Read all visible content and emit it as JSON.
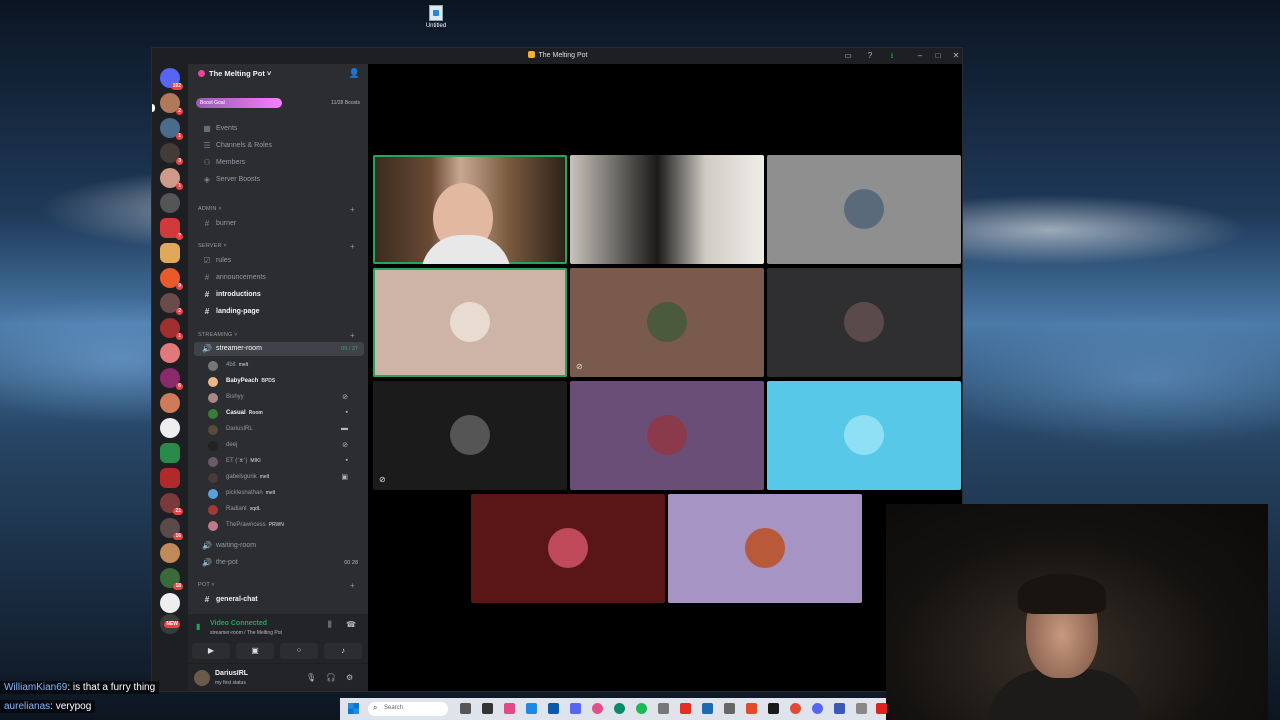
{
  "desktop": {
    "icon_label": "Untitled"
  },
  "window": {
    "title": "The Melting Pot"
  },
  "server": {
    "name": "The Melting Pot",
    "boost_label": "Boost Goal",
    "boost_count": "11/28 Boosts",
    "boost_progress": 0.39
  },
  "guild_badges": [
    "192",
    "2",
    "1",
    "3",
    "1",
    "7",
    "9",
    "2",
    "1",
    "6",
    "21",
    "16",
    "18",
    "NEW"
  ],
  "menu": [
    "Events",
    "Channels & Roles",
    "Members",
    "Server Boosts"
  ],
  "categories": {
    "admin": "ADMIN",
    "server": "server",
    "streaming": "streaming",
    "pot": "pot"
  },
  "channels": {
    "burner": "burner",
    "rules": "rules",
    "announcements": "announcements",
    "introductions": "introductions",
    "landing_page": "landing-page",
    "streamer_room": "streamer-room",
    "streamer_room_count": "09 / 37",
    "waiting_room": "waiting-room",
    "the_pot": "the-pot",
    "the_pot_count": "00  28",
    "general_chat": "general-chat"
  },
  "voice_users": [
    {
      "name": "4bit",
      "tag": "melt"
    },
    {
      "name": "BabyPeach",
      "tag": "BPDS"
    },
    {
      "name": "Bishyy",
      "tag": ""
    },
    {
      "name": "Casual",
      "tag": "Room"
    },
    {
      "name": "DariusIRL",
      "tag": ""
    },
    {
      "name": "deej",
      "tag": ""
    },
    {
      "name": "ET (ᵔᴥᵔ)",
      "tag": "MIKI"
    },
    {
      "name": "gabelsgunk",
      "tag": "melt"
    },
    {
      "name": "picklesnathan",
      "tag": "melt"
    },
    {
      "name": "Radiant",
      "tag": "sqdL"
    },
    {
      "name": "ThePrawncess",
      "tag": "PRWN"
    }
  ],
  "voice_panel": {
    "status": "Video Connected",
    "location": "streamer-room / The Melting Pot"
  },
  "user_panel": {
    "name": "DariusIRL",
    "status": "my first status"
  },
  "stream_chat": [
    {
      "user": "WilliamKian69",
      "text": ": is that a furry thing"
    },
    {
      "user": "aurelianas",
      "text": ": verypog"
    }
  ],
  "taskbar": {
    "search_placeholder": "Search"
  },
  "tile_colors": [
    "#3a2a20",
    "#cfd0c8",
    "#8f8f8f",
    "#cdb4a6",
    "#7a5a4c",
    "#2f2f31",
    "#1b1b1c",
    "#6b4e78",
    "#57c8e8",
    "#5a1616",
    "#a695c4"
  ]
}
